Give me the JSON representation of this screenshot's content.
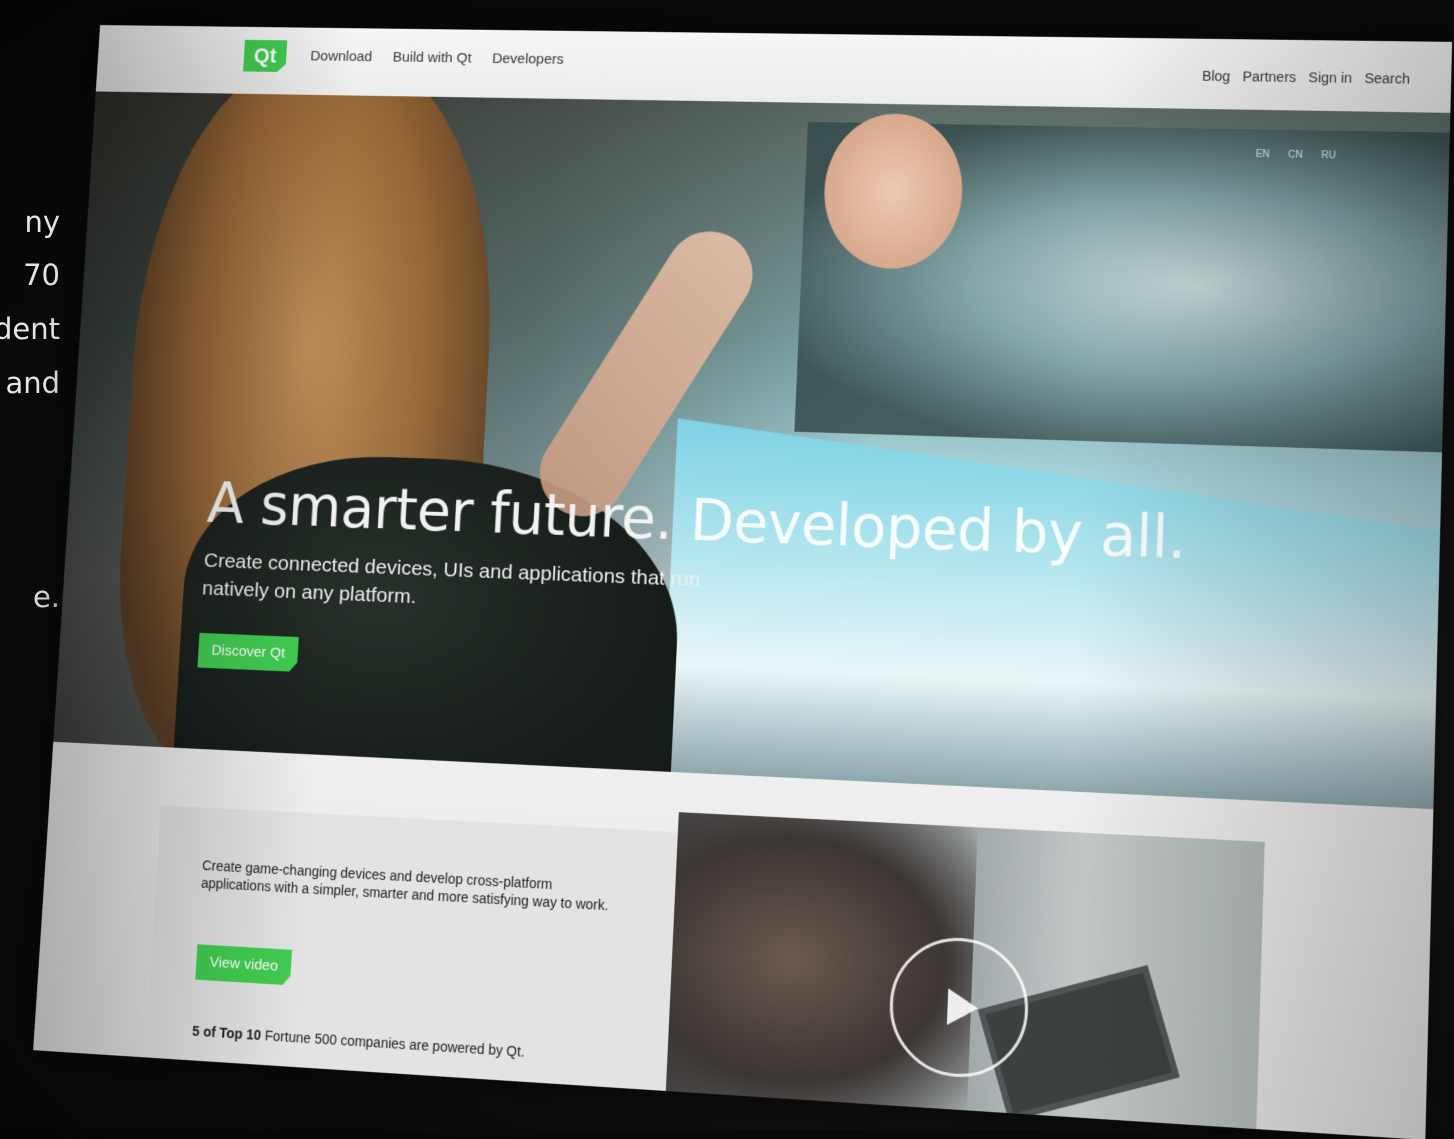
{
  "side_text": [
    "ny",
    "70",
    "dent",
    "and",
    "e."
  ],
  "header": {
    "logo": "Qt",
    "nav_left": [
      "Download",
      "Build with Qt",
      "Developers"
    ],
    "nav_right": [
      "Blog",
      "Partners",
      "Sign in",
      "Search"
    ]
  },
  "hero": {
    "languages": [
      "EN",
      "CN",
      "RU"
    ],
    "headline_strong": "A smarter future.",
    "headline_light": "Developed by all.",
    "subline": "Create connected devices, UIs and applications that run natively on any platform.",
    "cta": "Discover Qt"
  },
  "lower": {
    "card_text": "Create game-changing devices and develop cross-platform applications with a simpler, smarter and more satisfying way to work.",
    "video_button": "View video",
    "fortune_bold": "5 of Top 10",
    "fortune_rest": "Fortune 500 companies are powered by Qt."
  },
  "colors": {
    "brand_green": "#41cd52",
    "header_bg": "#f2f2f2",
    "page_bg": "#0a0a0a"
  },
  "icons": {
    "video_play": "play-icon"
  }
}
